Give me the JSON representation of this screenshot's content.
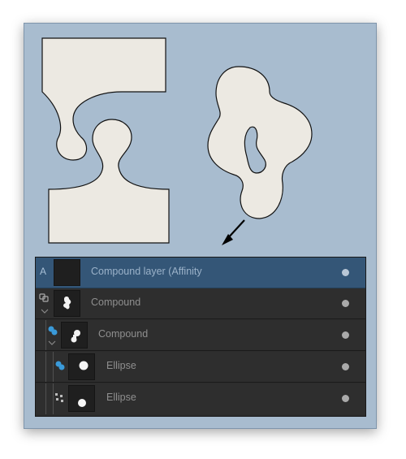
{
  "colors": {
    "canvas_bg": "#a8bccf",
    "shape_fill": "#ece9e2",
    "shape_stroke": "#111111",
    "panel_bg": "#2e2e2e",
    "row_selected": "#345677",
    "accent_blue": "#3a9ad9",
    "label_gray": "#8f8f8f"
  },
  "layers_panel": {
    "rows": [
      {
        "label": "Compound layer (Affinity",
        "indicator": "A",
        "icon": "empty-thumbnail",
        "selected": true
      },
      {
        "label": "Compound",
        "indicator": "compound-link-icon",
        "icon": "compound-thumbnail",
        "expanded": true
      },
      {
        "label": "Compound",
        "indicator": "compound-blue-icon",
        "icon": "compound-thumbnail",
        "expanded": true
      },
      {
        "label": "Ellipse",
        "indicator": "add-mode-icon",
        "icon": "ellipse-thumbnail"
      },
      {
        "label": "Ellipse",
        "indicator": "subtract-mode-icon",
        "icon": "ellipse-thumbnail"
      }
    ]
  }
}
